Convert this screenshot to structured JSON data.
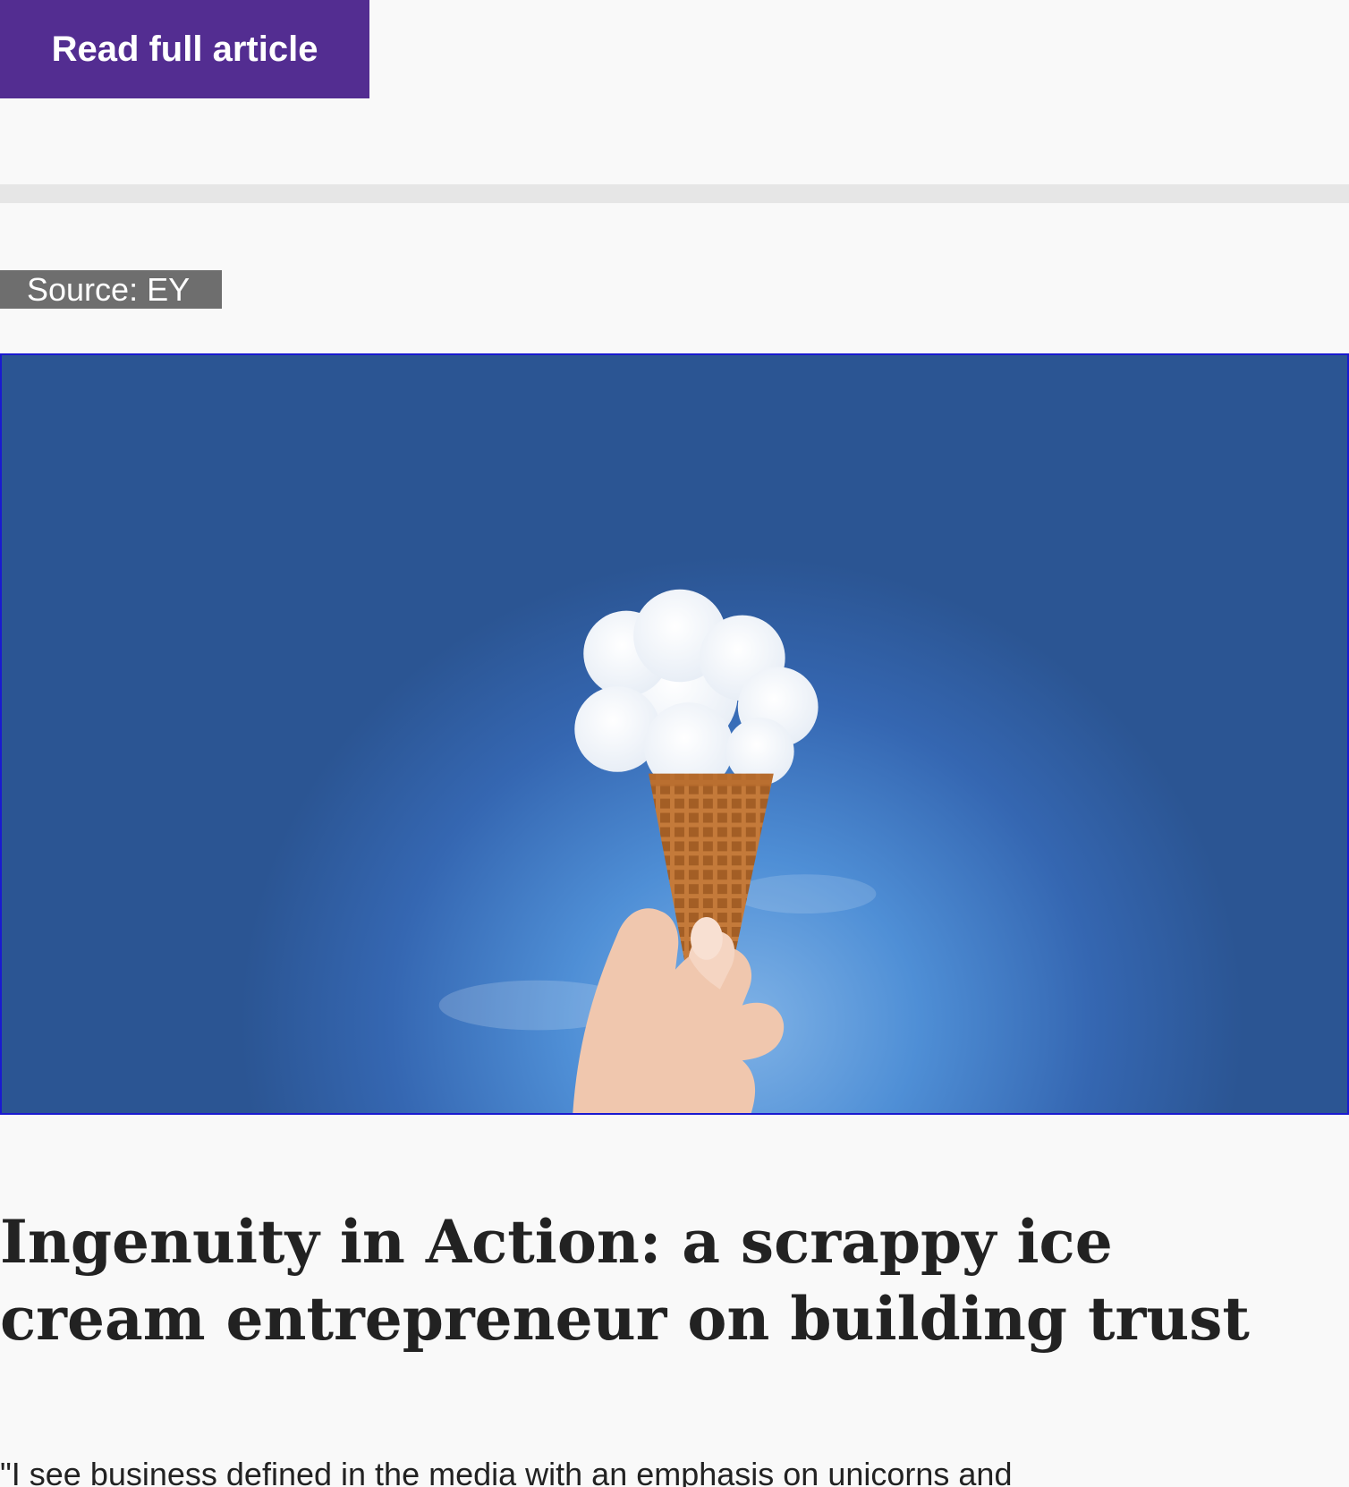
{
  "cta": {
    "read_full_article": "Read full article"
  },
  "article": {
    "source": "Source: EY",
    "image_icon": "ice-cream-cloud-photo",
    "title": "Ingenuity in Action: a scrappy ice cream entrepreneur on building trust",
    "body_start": "\"I see business defined in the media with an emphasis on unicorns and"
  },
  "colors": {
    "button": "#532d91",
    "divider": "#e6e6e6",
    "badge": "#6e6e6e",
    "image_border": "#1a1ad0",
    "sky": "#3567b2"
  }
}
